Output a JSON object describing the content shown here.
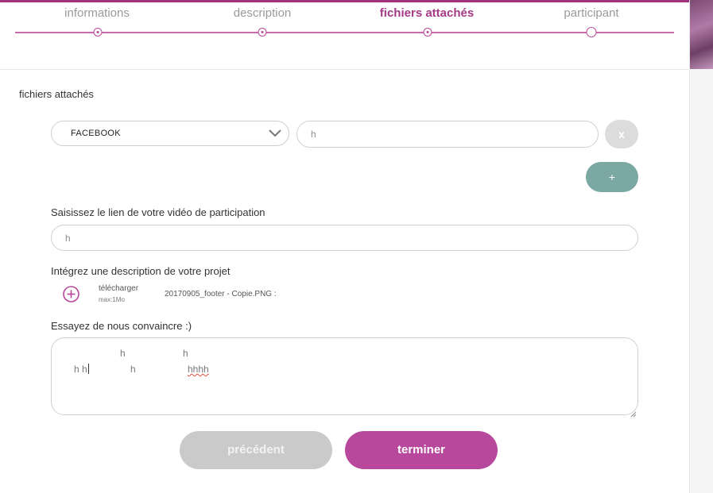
{
  "steps": [
    {
      "label": "informations",
      "state": "done"
    },
    {
      "label": "description",
      "state": "done"
    },
    {
      "label": "fichiers attachés",
      "state": "active"
    },
    {
      "label": "participant",
      "state": "todo"
    }
  ],
  "section_title": "fichiers attachés",
  "link_row": {
    "network_select_value": "FACEBOOK",
    "url_input_value": "h",
    "remove_label": "x",
    "add_label": "+"
  },
  "video": {
    "label": "Saisissez le lien de votre vidéo de participation",
    "value": "h"
  },
  "description_file": {
    "label": "Intégrez une description de votre projet",
    "upload_label": "télécharger",
    "upload_hint": "max:1Mo",
    "file_name": "20170905_footer - Copie.PNG :"
  },
  "pitch": {
    "label": "Essayez de nous convaincre :)",
    "text_fragments": [
      "h",
      "h",
      "h h",
      "h",
      "hhhh"
    ]
  },
  "nav": {
    "prev_label": "précédent",
    "next_label": "terminer"
  },
  "colors": {
    "accent": "#b8489b",
    "accent_dark": "#a53985",
    "add_button": "#7ba8a2",
    "disabled": "#cacaca"
  },
  "icons": [
    "chevron-down-icon",
    "close-icon",
    "plus-icon",
    "upload-plus-icon"
  ]
}
